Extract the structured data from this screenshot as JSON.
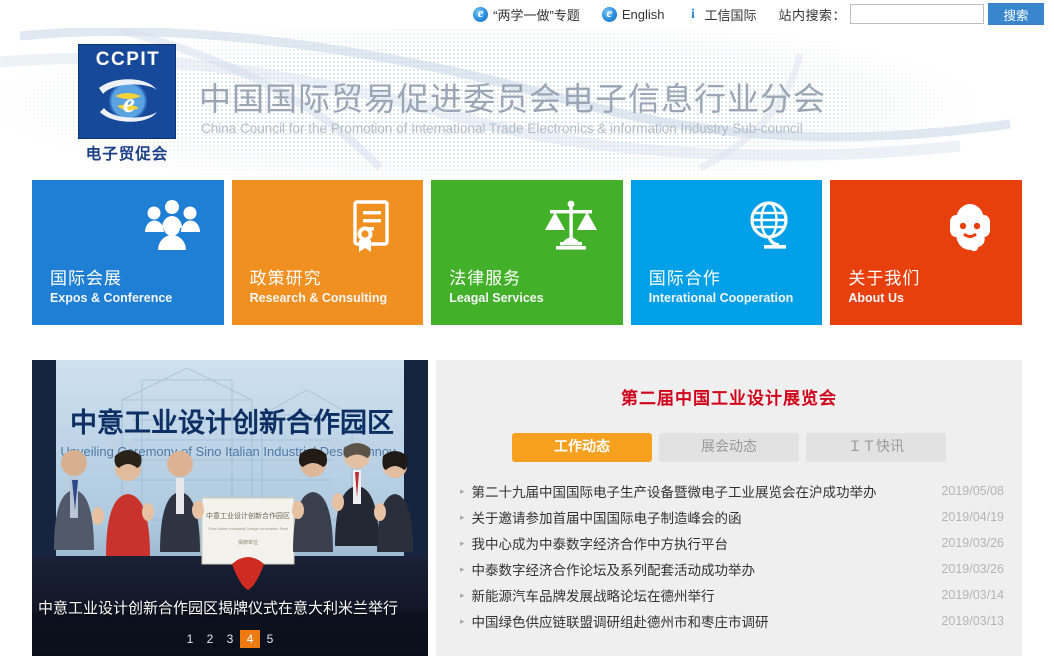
{
  "topbar": {
    "links": [
      {
        "label": "“两学一做”专题",
        "icon": "ie-browser-icon"
      },
      {
        "label": "English",
        "icon": "ie-browser-icon"
      },
      {
        "label": "工信国际",
        "icon": "info-icon"
      }
    ],
    "search": {
      "label": "站内搜索：",
      "value": "",
      "placeholder": "",
      "button": "搜索"
    }
  },
  "header": {
    "logo": {
      "top_text": "CCPIT",
      "bottom_text": "电子贸促会",
      "brand_color": "#17499a"
    },
    "title": "中国国际贸易促进委员会电子信息行业分会",
    "subtitle": "China Council for the Promotion of International Trade Electronics & information Industry Sub-council"
  },
  "tiles": [
    {
      "cn": "国际会展",
      "en": "Expos & Conference",
      "color": "#1e7fd4",
      "icon": "people-group-icon"
    },
    {
      "cn": "政策研究",
      "en": "Research & Consulting",
      "color": "#ef9020",
      "icon": "certificate-icon"
    },
    {
      "cn": "法律服务",
      "en": "Leagal Services",
      "color": "#43b02a",
      "icon": "scales-balance-icon"
    },
    {
      "cn": "国际合作",
      "en": "Interational Cooperation",
      "color": "#00a0e9",
      "icon": "globe-stand-icon"
    },
    {
      "cn": "关于我们",
      "en": "About Us",
      "color": "#e8400c",
      "icon": "headset-support-icon"
    }
  ],
  "carousel": {
    "caption": "中意工业设计创新合作园区揭牌仪式在意大利米兰举行",
    "slide_overlay_title": "中意工业设计创新合作园区",
    "slide_overlay_subtitle": "Unveiling Ceremony of Sino Italian Industrial Design Innov",
    "pages": [
      "1",
      "2",
      "3",
      "4",
      "5"
    ],
    "active_page": "4"
  },
  "news": {
    "title": "第二届中国工业设计展览会",
    "tabs": [
      {
        "label": "工作动态",
        "active": true
      },
      {
        "label": "展会动态",
        "active": false
      },
      {
        "label": "ＩＴ快讯",
        "active": false
      }
    ],
    "items": [
      {
        "text": "第二十九届中国国际电子生产设备暨微电子工业展览会在沪成功举办",
        "date": "2019/05/08"
      },
      {
        "text": "关于邀请参加首届中国国际电子制造峰会的函",
        "date": "2019/04/19"
      },
      {
        "text": "我中心成为中泰数字经济合作中方执行平台",
        "date": "2019/03/26"
      },
      {
        "text": "中泰数字经济合作论坛及系列配套活动成功举办",
        "date": "2019/03/26"
      },
      {
        "text": "新能源汽车品牌发展战略论坛在德州举行",
        "date": "2019/03/14"
      },
      {
        "text": "中国绿色供应链联盟调研组赴德州市和枣庄市调研",
        "date": "2019/03/13"
      }
    ]
  }
}
